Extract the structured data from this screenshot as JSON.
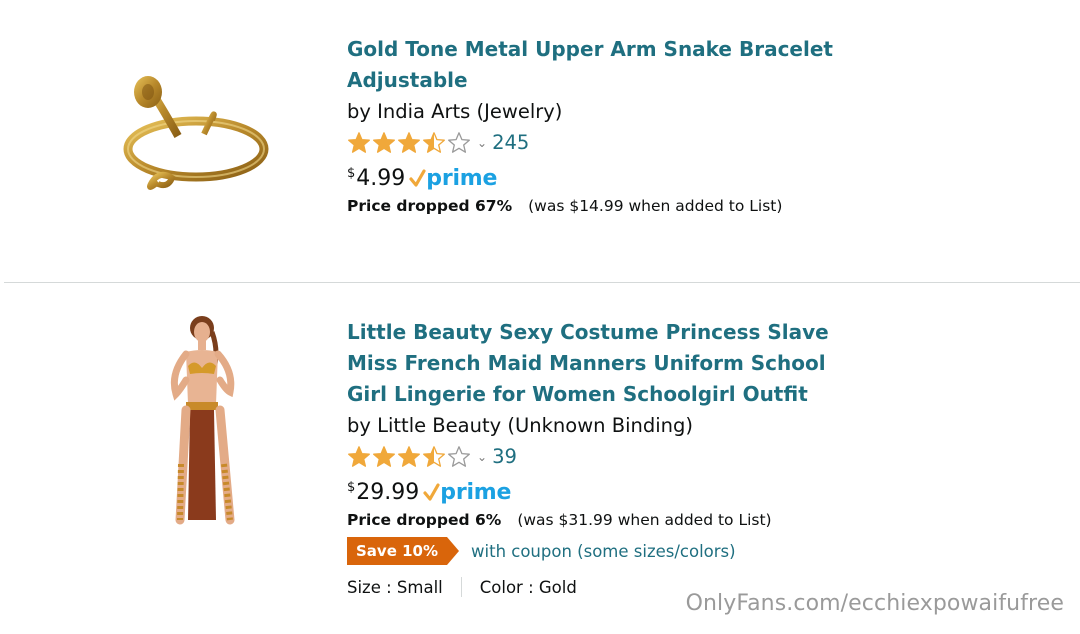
{
  "items": [
    {
      "title_lines": [
        "Gold Tone Metal Upper Arm Snake Bracelet",
        "Adjustable"
      ],
      "byline": "by India Arts (Jewelry)",
      "rating_stars": 3.5,
      "rating_count": "245",
      "price_currency": "$",
      "price_amount": "4.99",
      "prime_label": "prime",
      "drop_label": "Price dropped 67%",
      "was_text": "(was $14.99 when added to List)"
    },
    {
      "title_lines": [
        "Little Beauty Sexy Costume Princess Slave",
        "Miss French Maid Manners Uniform School",
        "Girl Lingerie for Women Schoolgirl Outfit"
      ],
      "byline": "by Little Beauty (Unknown Binding)",
      "rating_stars": 3.5,
      "rating_count": "39",
      "price_currency": "$",
      "price_amount": "29.99",
      "prime_label": "prime",
      "drop_label": "Price dropped 6%",
      "was_text": "(was $31.99 when added to List)",
      "coupon_badge": "Save 10%",
      "coupon_text": "with coupon (some sizes/colors)",
      "size_text": "Size : Small",
      "color_text": "Color : Gold"
    }
  ],
  "colors": {
    "title_link": "#1f6f80",
    "star": "#f0a83a",
    "prime": "#1ba1e2",
    "coupon_badge": "#d9650b"
  },
  "watermark": "OnlyFans.com/ecchiexpowaifufree"
}
